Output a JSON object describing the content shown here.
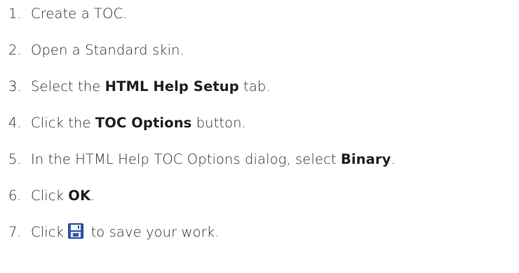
{
  "steps": [
    {
      "number": "1.",
      "parts": [
        "Create a TOC."
      ]
    },
    {
      "number": "2.",
      "parts": [
        "Open a Standard skin."
      ]
    },
    {
      "number": "3.",
      "parts": [
        "Select the ",
        "HTML Help Setup",
        " tab."
      ]
    },
    {
      "number": "4.",
      "parts": [
        "Click the ",
        "TOC Options",
        " button."
      ]
    },
    {
      "number": "5.",
      "parts": [
        "In the HTML Help TOC Options dialog, select ",
        "Binary",
        "."
      ]
    },
    {
      "number": "6.",
      "parts": [
        "Click ",
        "OK",
        "."
      ]
    },
    {
      "number": "7.",
      "parts": [
        "Click ",
        " to save your work."
      ],
      "icon": "save-icon"
    }
  ]
}
